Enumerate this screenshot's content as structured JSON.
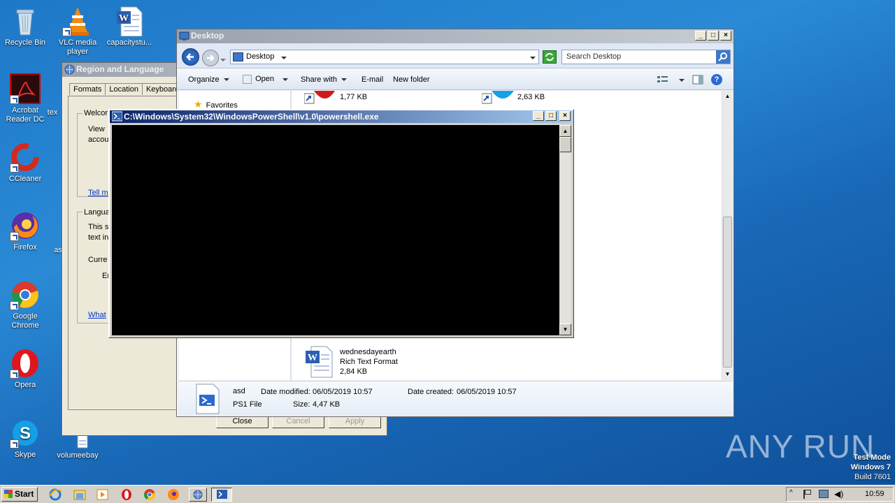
{
  "desktop": {
    "icons": [
      {
        "label": "Recycle Bin"
      },
      {
        "label": "VLC media player"
      },
      {
        "label": "capacitystu..."
      },
      {
        "label": "Acrobat Reader DC"
      },
      {
        "label": "tex"
      },
      {
        "label": "CCleaner"
      },
      {
        "label": "Firefox"
      },
      {
        "label": "as"
      },
      {
        "label": "Google Chrome"
      },
      {
        "label": "Opera"
      },
      {
        "label": "Skype"
      },
      {
        "label": "volumeebay"
      }
    ],
    "watermark": "ANY RUN",
    "test_mode": {
      "line1": "Test Mode",
      "line2": "Windows 7",
      "line3": "Build 7601"
    }
  },
  "region_dialog": {
    "title": "Region and Language",
    "tabs": [
      "Formats",
      "Location",
      "Keyboard"
    ],
    "group1_label": "Welcor",
    "group1_text1": "View",
    "group1_text2": "accou",
    "link1": "Tell m",
    "group2_label": "Langua",
    "group2_text1": "This s",
    "group2_text2": "text in",
    "current_label": "Curre",
    "current_value": "Er",
    "link2": "What",
    "buttons": {
      "close": "Close",
      "cancel": "Cancel",
      "apply": "Apply"
    }
  },
  "explorer": {
    "title": "Desktop",
    "address": "Desktop",
    "search_placeholder": "Search Desktop",
    "toolbar": {
      "organize": "Organize",
      "open": "Open",
      "share": "Share with",
      "email": "E-mail",
      "new_folder": "New folder"
    },
    "nav": {
      "favorites": "Favorites"
    },
    "files": [
      {
        "size": "1,77 KB"
      },
      {
        "size": "2,63 KB"
      },
      {
        "name": "wednesdayearth",
        "type": "Rich Text Format",
        "size": "2,84 KB"
      }
    ],
    "details": {
      "name": "asd",
      "type": "PS1 File",
      "modified_label": "Date modified:",
      "modified_value": "06/05/2019 10:57",
      "created_label": "Date created:",
      "created_value": "06/05/2019 10:57",
      "size_label": "Size:",
      "size_value": "4,47 KB"
    }
  },
  "powershell": {
    "title": "C:\\Windows\\System32\\WindowsPowerShell\\v1.0\\powershell.exe"
  },
  "taskbar": {
    "start": "Start",
    "clock": "10:59"
  }
}
